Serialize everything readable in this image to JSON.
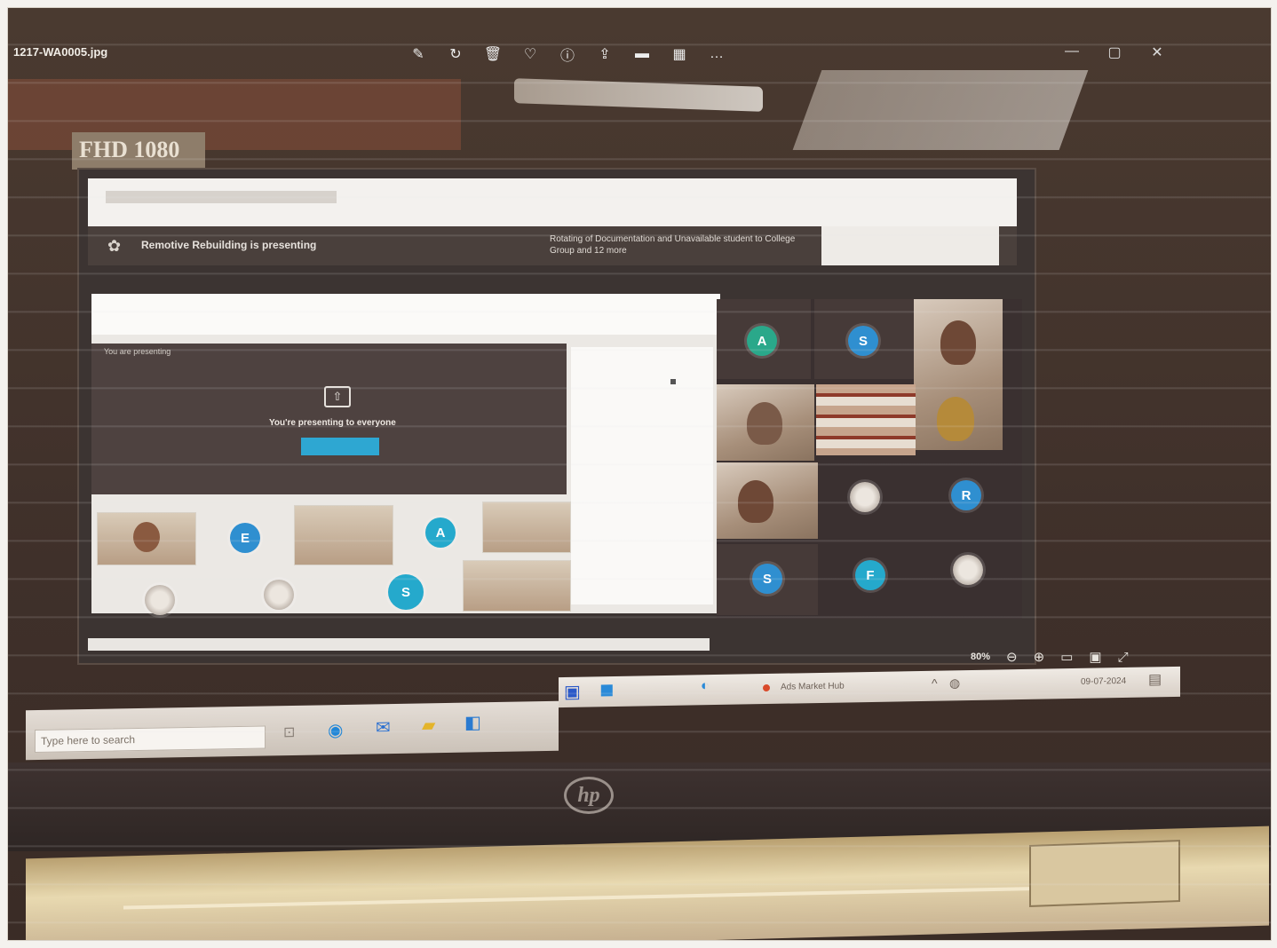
{
  "viewer": {
    "filename": "1217-WA0005.jpg",
    "tools": [
      {
        "icon": "edit-icon",
        "glyph": "✎"
      },
      {
        "icon": "rotate-icon",
        "glyph": "↻"
      },
      {
        "icon": "delete-icon",
        "glyph": "🗑"
      },
      {
        "icon": "favorite-icon",
        "glyph": "♡"
      },
      {
        "icon": "info-icon",
        "glyph": "ⓘ"
      },
      {
        "icon": "share-icon",
        "glyph": "⇪"
      },
      {
        "icon": "folder-icon",
        "glyph": "▬"
      },
      {
        "icon": "print-icon",
        "glyph": "▦"
      },
      {
        "icon": "more-icon",
        "glyph": "…"
      }
    ],
    "window_buttons": [
      "—",
      "▢",
      "✕"
    ],
    "zoom_level": "80%"
  },
  "monitor_label": "FHD 1080",
  "meet": {
    "header_title": "Remotive Rebuilding is presenting",
    "notice": "Rotating of Documentation and Unavailable student to College Group and 12 more",
    "presenter_title": "You are presenting",
    "share_message": "You're presenting to everyone",
    "avatars_left": [
      "E",
      "A",
      "S"
    ],
    "avatars_right": [
      "A",
      "S",
      "R",
      "S",
      "F"
    ]
  },
  "taskbar": {
    "search_placeholder": "Type here to search",
    "tray_text": "Ads Market Hub",
    "date": "09-07-2024"
  },
  "brand_logo": "hp",
  "colors": {
    "accent": "#2ea7d2",
    "avatar_teal": "#2a9fa8",
    "alert_dot": "#d94a2a"
  }
}
